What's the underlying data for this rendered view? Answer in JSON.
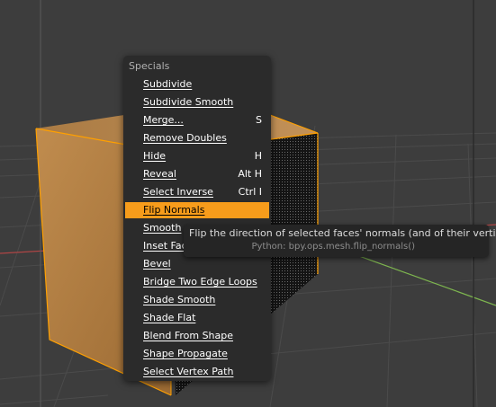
{
  "colors": {
    "background": "#3d3d3d",
    "menu_bg": "#2b2b2b",
    "highlight": "#f79c1b",
    "selection_outline": "#ffa000",
    "grid_red": "#b04545",
    "grid_green": "#7eb64f"
  },
  "menu": {
    "title": "Specials",
    "items": [
      {
        "label": "Subdivide",
        "shortcut": ""
      },
      {
        "label": "Subdivide Smooth",
        "shortcut": ""
      },
      {
        "label": "Merge...",
        "shortcut": "S"
      },
      {
        "label": "Remove Doubles",
        "shortcut": ""
      },
      {
        "label": "Hide",
        "shortcut": "H"
      },
      {
        "label": "Reveal",
        "shortcut": "Alt H"
      },
      {
        "label": "Select Inverse",
        "shortcut": "Ctrl I"
      },
      {
        "label": "Flip Normals",
        "shortcut": "",
        "highlighted": true
      },
      {
        "label": "Smooth",
        "shortcut": ""
      },
      {
        "label": "Inset Faces",
        "shortcut": ""
      },
      {
        "label": "Bevel",
        "shortcut": ""
      },
      {
        "label": "Bridge Two Edge Loops",
        "shortcut": ""
      },
      {
        "label": "Shade Smooth",
        "shortcut": ""
      },
      {
        "label": "Shade Flat",
        "shortcut": ""
      },
      {
        "label": "Blend From Shape",
        "shortcut": ""
      },
      {
        "label": "Shape Propagate",
        "shortcut": ""
      },
      {
        "label": "Select Vertex Path",
        "shortcut": ""
      }
    ]
  },
  "tooltip": {
    "description": "Flip the direction of selected faces' normals (and of their vertices)",
    "python": "Python: bpy.ops.mesh.flip_normals()"
  }
}
